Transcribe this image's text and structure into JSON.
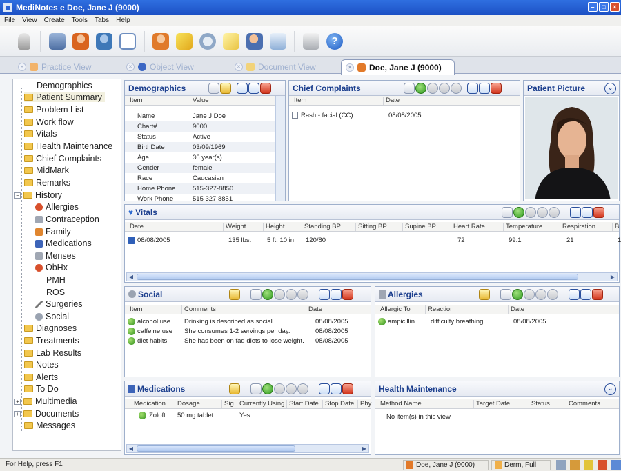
{
  "window": {
    "title": "MediNotes e   Doe, Jane J (9000)"
  },
  "menu": [
    "File",
    "View",
    "Create",
    "Tools",
    "Tabs",
    "Help"
  ],
  "toolbar_icons": [
    "lock-icon",
    "patient-lookup-icon",
    "user-icon",
    "users-icon",
    "search-document-icon",
    "add-user-icon",
    "pen-icon",
    "chat-icon",
    "notepad-edit-icon",
    "user-edit-icon",
    "export-icon",
    "print-icon",
    "help-icon"
  ],
  "tabs": [
    {
      "label": "Practice View"
    },
    {
      "label": "Object View"
    },
    {
      "label": "Document View"
    },
    {
      "label": "Doe, Jane J (9000)"
    }
  ],
  "tree": {
    "items": [
      "Demographics",
      "Patient Summary",
      "Problem List",
      "Work flow",
      "Vitals",
      "Health Maintenance",
      "Chief Complaints",
      "MidMark",
      "Remarks",
      "History",
      "Allergies",
      "Contraception",
      "Family",
      "Medications",
      "Menses",
      "ObHx",
      "PMH",
      "ROS",
      "Surgeries",
      "Social",
      "Diagnoses",
      "Treatments",
      "Lab Results",
      "Notes",
      "Alerts",
      "To Do",
      "Multimedia",
      "Documents",
      "Messages"
    ]
  },
  "demographics": {
    "title": "Demographics",
    "columns": [
      "Item",
      "Value"
    ],
    "rows": [
      [
        "Name",
        "Jane J Doe"
      ],
      [
        "Chart#",
        "9000"
      ],
      [
        "Status",
        "Active"
      ],
      [
        "BirthDate",
        "03/09/1969"
      ],
      [
        "Age",
        "36 year(s)"
      ],
      [
        "Gender",
        "female"
      ],
      [
        "Race",
        "Caucasian"
      ],
      [
        "Home Phone",
        "515-327-8850"
      ],
      [
        "Work Phone",
        "515 327 8851"
      ]
    ]
  },
  "chief_complaints": {
    "title": "Chief Complaints",
    "columns": [
      "Item",
      "Date"
    ],
    "rows": [
      [
        "Rash - facial (CC)",
        "08/08/2005"
      ]
    ]
  },
  "patient_picture": {
    "title": "Patient Picture"
  },
  "vitals": {
    "title": "Vitals",
    "columns": [
      "Date",
      "Weight",
      "Height",
      "Standing BP",
      "Sitting BP",
      "Supine BP",
      "Heart Rate",
      "Temperature",
      "Respiration",
      "B"
    ],
    "rows": [
      [
        "08/08/2005",
        "135 lbs.",
        "5 ft. 10 in.",
        "120/80",
        "",
        "",
        "72",
        "99.1",
        "21",
        "1"
      ]
    ]
  },
  "social": {
    "title": "Social",
    "columns": [
      "Item",
      "Comments",
      "Date"
    ],
    "rows": [
      [
        "alcohol use",
        "Drinking is described as social.",
        "08/08/2005"
      ],
      [
        "caffeine use",
        "She consumes 1-2 servings per day.",
        "08/08/2005"
      ],
      [
        "diet habits",
        "She has been on fad diets to lose weight.",
        "08/08/2005"
      ]
    ]
  },
  "allergies": {
    "title": "Allergies",
    "columns": [
      "Allergic To",
      "Reaction",
      "Date"
    ],
    "rows": [
      [
        "ampicillin",
        "difficulty breathing",
        "08/08/2005"
      ]
    ]
  },
  "medications": {
    "title": "Medications",
    "columns": [
      "Medication",
      "Dosage",
      "Sig",
      "Currently Using",
      "Start Date",
      "Stop Date",
      "Phy"
    ],
    "rows": [
      [
        "Zoloft",
        "50 mg tablet",
        "",
        "Yes",
        "",
        "",
        ""
      ]
    ]
  },
  "health_maintenance": {
    "title": "Health Maintenance",
    "columns": [
      "Method Name",
      "Target Date",
      "Status",
      "Comments"
    ],
    "empty": "No item(s) in this view"
  },
  "status": {
    "help": "For Help, press F1",
    "patient": "Doe, Jane J (9000)",
    "user": "Derm, Full"
  },
  "colors": {
    "accent": "#1c3f8e",
    "titlebar": "#2a62d6",
    "folder": "#f2c74e",
    "green": "#2e8d1a",
    "red": "#d2351c"
  }
}
